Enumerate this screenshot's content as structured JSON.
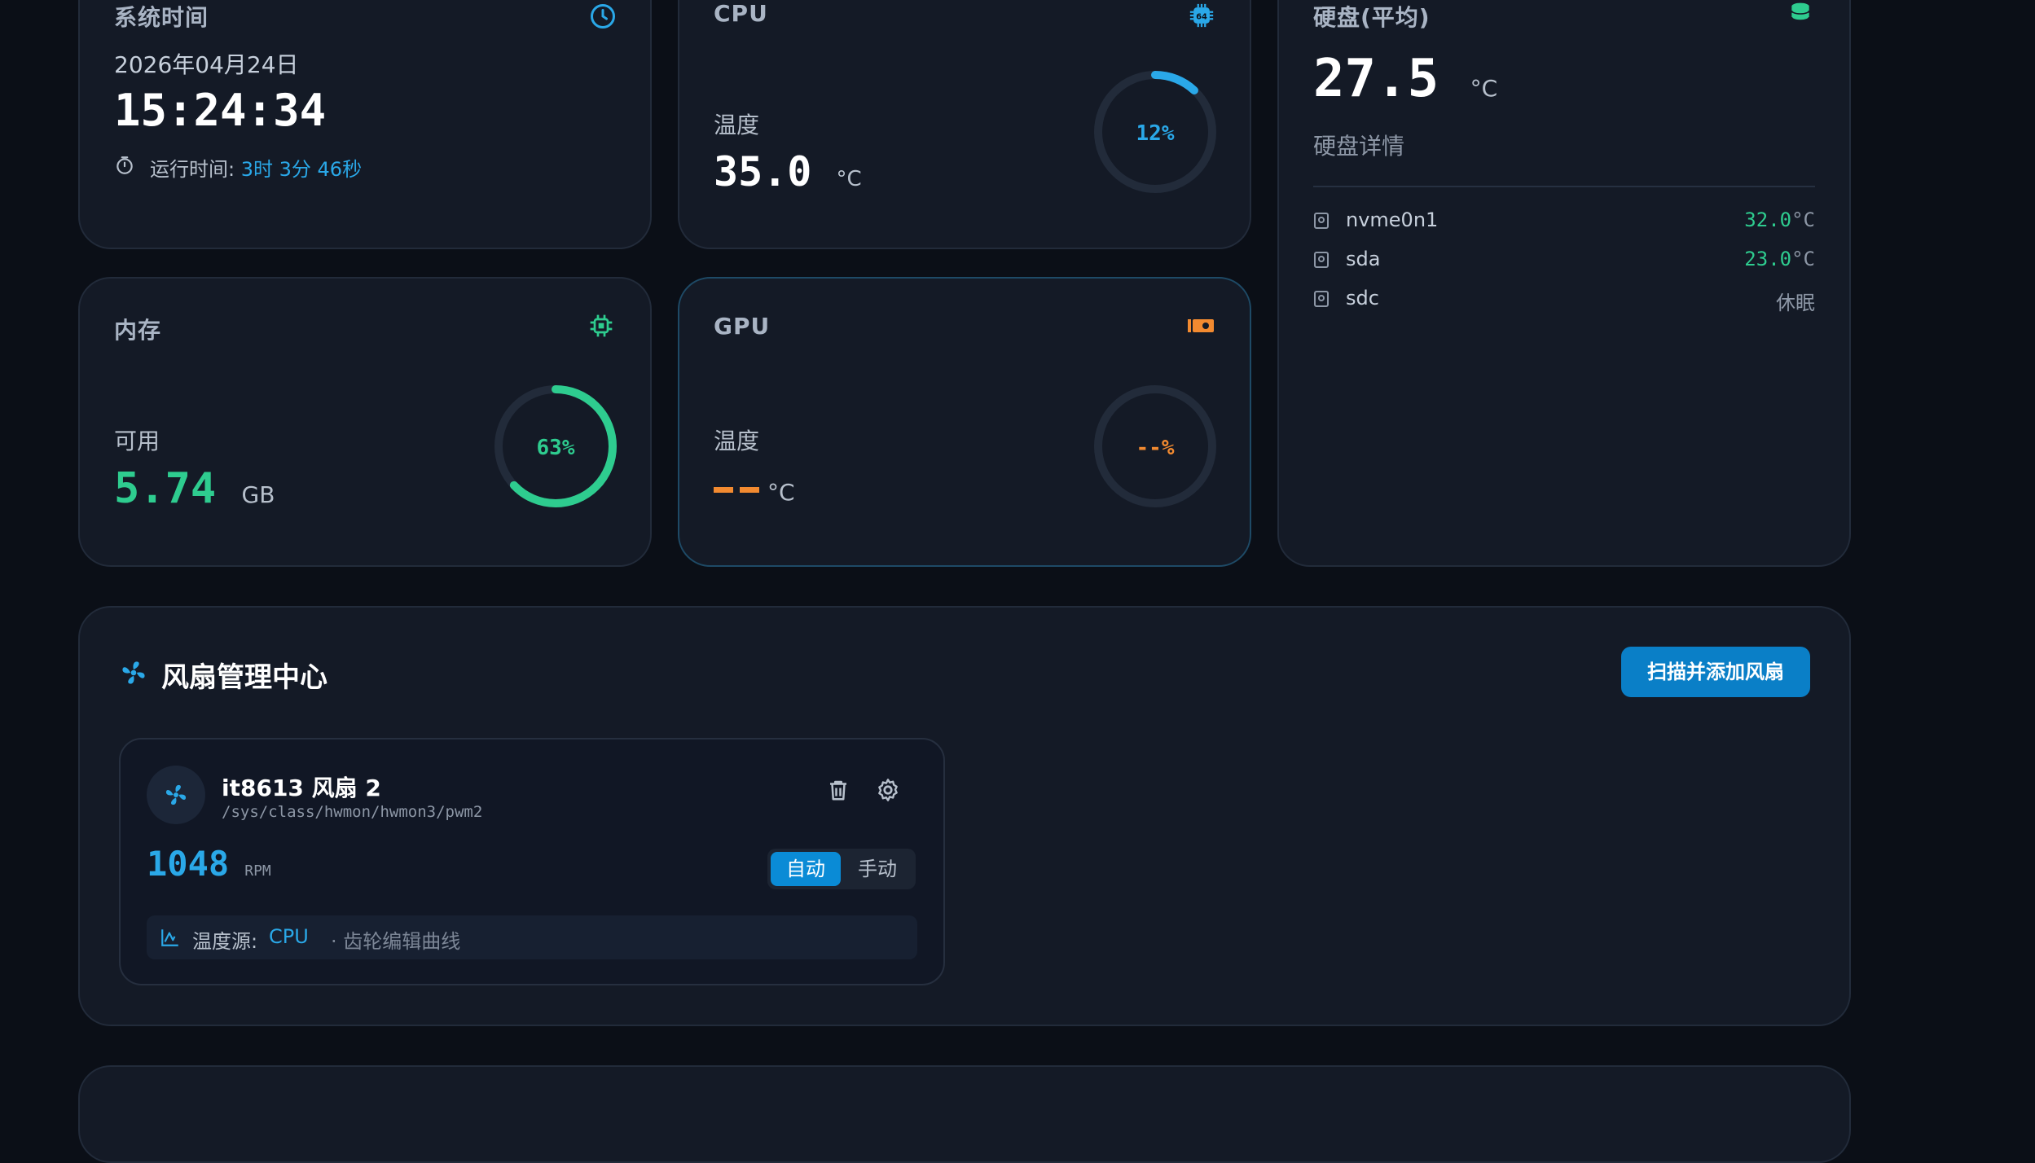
{
  "time_card": {
    "title": "系统时间",
    "date": "2026年04月24日",
    "time": "15:24:34",
    "uptime_label": "运行时间:",
    "uptime_value": "3时 3分 46秒"
  },
  "cpu_card": {
    "title": "CPU",
    "temp_label": "温度",
    "temp_value": "35.0",
    "temp_unit": "°C",
    "usage_text": "12%",
    "usage_fraction": 0.12,
    "ring_color": "#2aa8e8"
  },
  "disk_card": {
    "title": "硬盘(平均)",
    "avg_value": "27.5",
    "avg_unit": "°C",
    "details_label": "硬盘详情",
    "disks": [
      {
        "name": "nvme0n1",
        "value": "32.0",
        "unit": "°C"
      },
      {
        "name": "sda",
        "value": "23.0",
        "unit": "°C"
      },
      {
        "name": "sdc",
        "value": "休眠",
        "unit": ""
      }
    ]
  },
  "mem_card": {
    "title": "内存",
    "avail_label": "可用",
    "avail_value": "5.74",
    "avail_unit": "GB",
    "usage_text": "63%",
    "usage_fraction": 0.63,
    "ring_color": "#2ecc8f"
  },
  "gpu_card": {
    "title": "GPU",
    "temp_label": "温度",
    "temp_unit": "°C",
    "usage_text": "--%",
    "ring_color": "#f28a30"
  },
  "fan_center": {
    "title": "风扇管理中心",
    "scan_button": "扫描并添加风扇",
    "fan": {
      "name": "it8613 风扇 2",
      "path": "/sys/class/hwmon/hwmon3/pwm2",
      "rpm": "1048",
      "rpm_unit": "RPM",
      "mode_auto": "自动",
      "mode_manual": "手动",
      "source_label": "温度源:",
      "source_value": "CPU",
      "hint": "· 齿轮编辑曲线"
    }
  },
  "colors": {
    "accent_blue": "#2aa8e8",
    "accent_green": "#2ecc8f",
    "accent_orange": "#f28a30"
  }
}
